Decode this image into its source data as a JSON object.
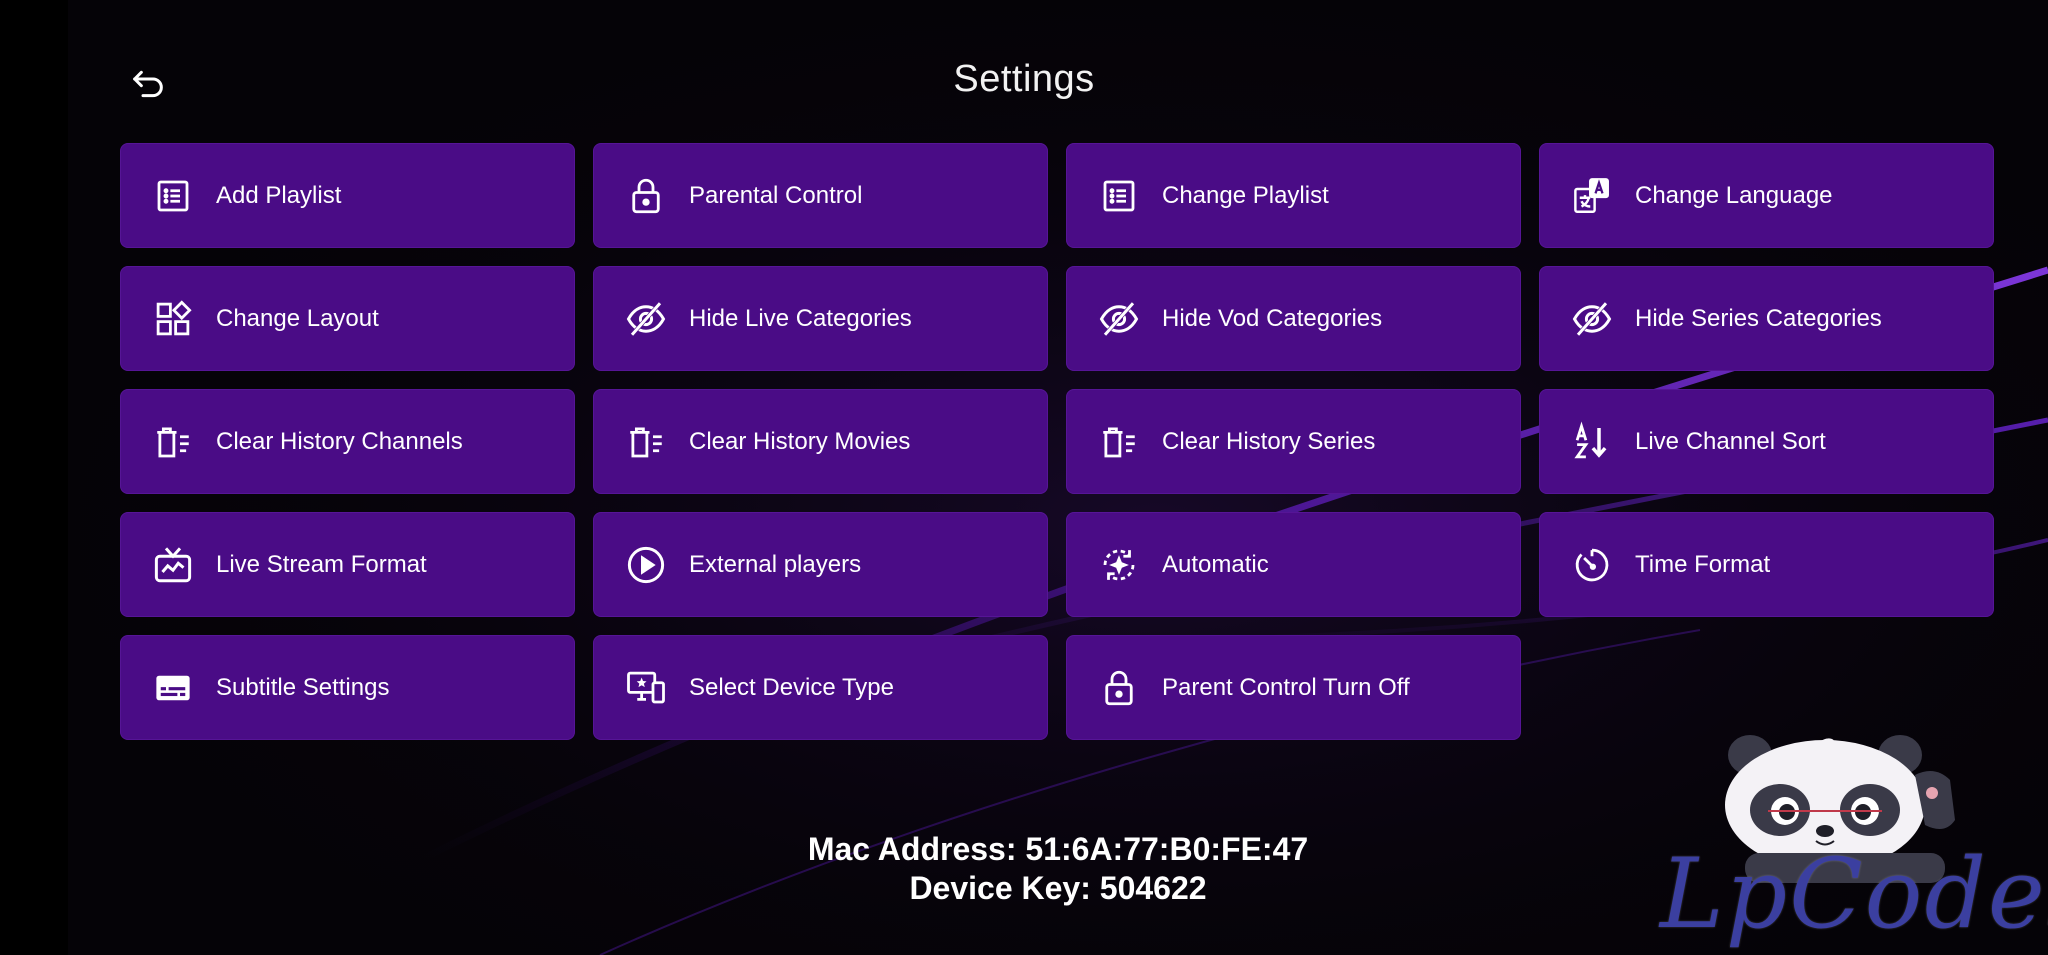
{
  "header": {
    "title": "Settings",
    "back_icon": "back-arrow-icon"
  },
  "tiles": [
    {
      "label": "Add Playlist",
      "icon": "list-icon"
    },
    {
      "label": "Parental Control",
      "icon": "lock-icon"
    },
    {
      "label": "Change Playlist",
      "icon": "list-icon"
    },
    {
      "label": "Change Language",
      "icon": "translate-icon"
    },
    {
      "label": "Change Layout",
      "icon": "layout-icon"
    },
    {
      "label": "Hide Live Categories",
      "icon": "eye-off-icon"
    },
    {
      "label": "Hide Vod Categories",
      "icon": "eye-off-icon"
    },
    {
      "label": "Hide Series Categories",
      "icon": "eye-off-icon"
    },
    {
      "label": "Clear History Channels",
      "icon": "delete-sweep-icon"
    },
    {
      "label": "Clear History Movies",
      "icon": "delete-sweep-icon"
    },
    {
      "label": "Clear History Series",
      "icon": "delete-sweep-icon"
    },
    {
      "label": "Live Channel Sort",
      "icon": "sort-alpha-icon"
    },
    {
      "label": "Live Stream Format",
      "icon": "live-tv-icon"
    },
    {
      "label": "External players",
      "icon": "play-circle-icon"
    },
    {
      "label": "Automatic",
      "icon": "auto-sync-icon"
    },
    {
      "label": "Time Format",
      "icon": "timer-icon"
    },
    {
      "label": "Subtitle Settings",
      "icon": "subtitles-icon"
    },
    {
      "label": "Select Device Type",
      "icon": "devices-icon"
    },
    {
      "label": "Parent Control Turn Off",
      "icon": "lock-icon"
    }
  ],
  "device": {
    "mac": "Mac Address: 51:6A:77:B0:FE:47",
    "key": "Device Key: 504622"
  },
  "watermark": {
    "text": "LpCodes",
    "mascot": "panda-icon"
  },
  "colors": {
    "tile_bg": "#4a0c86",
    "background": "#050307",
    "accent": "#6a1fd1"
  }
}
